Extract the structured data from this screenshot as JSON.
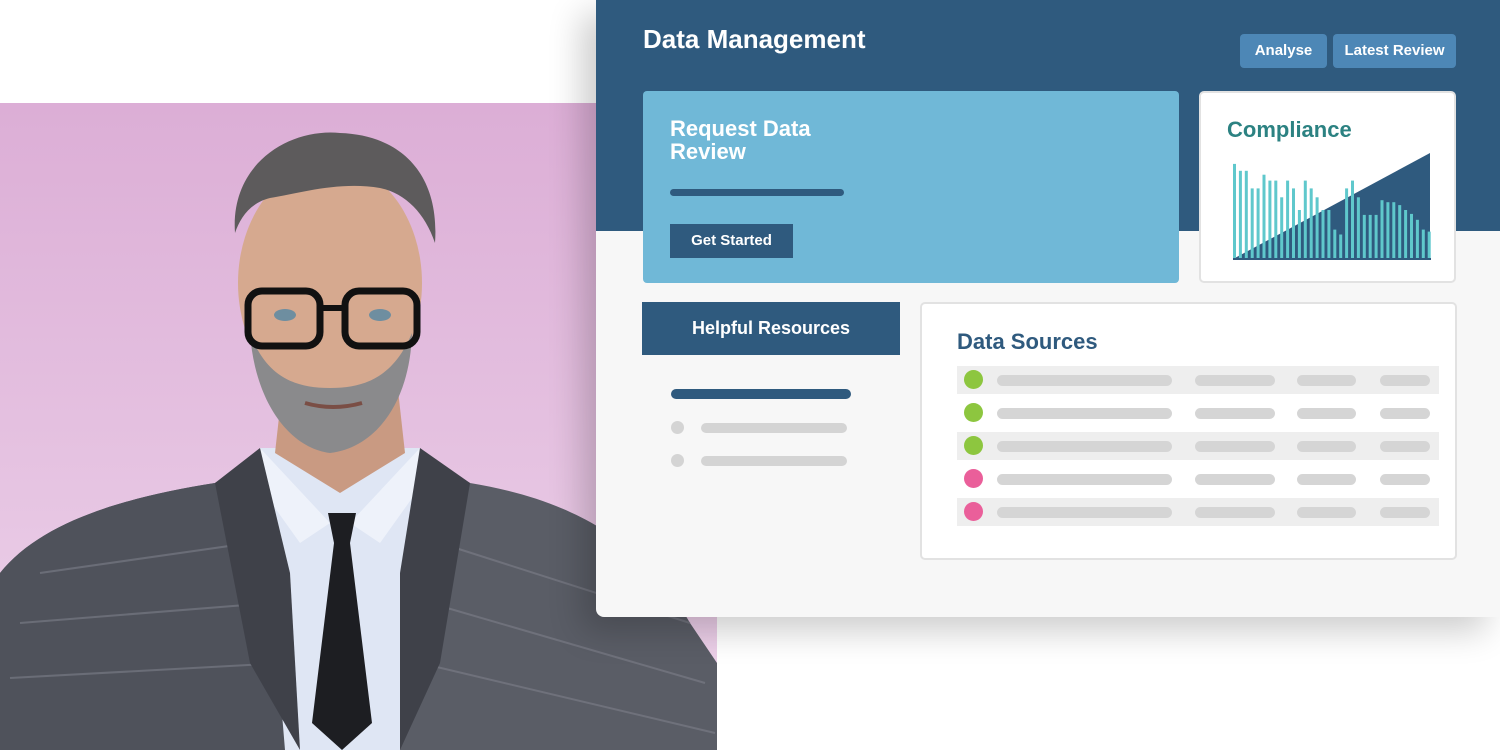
{
  "header": {
    "title": "Data Management",
    "buttons": {
      "analyse": "Analyse",
      "latest_review": "Latest Review"
    }
  },
  "request_card": {
    "title": "Request Data Review",
    "button": "Get Started"
  },
  "compliance": {
    "title": "Compliance"
  },
  "resources": {
    "title": "Helpful Resources"
  },
  "data_sources": {
    "title": "Data Sources",
    "rows": [
      {
        "status": "green"
      },
      {
        "status": "green"
      },
      {
        "status": "green"
      },
      {
        "status": "pink"
      },
      {
        "status": "pink"
      }
    ]
  },
  "colors": {
    "primary": "#2f5a7e",
    "accent_blue": "#70b8d7",
    "button_blue": "#4d87b6",
    "teal": "#2c8282",
    "chart_bars": "#5fc8cc",
    "status_green": "#8dc63f",
    "status_pink": "#ea5f9a"
  },
  "icons": [
    "status-dot",
    "bullet-dot"
  ]
}
